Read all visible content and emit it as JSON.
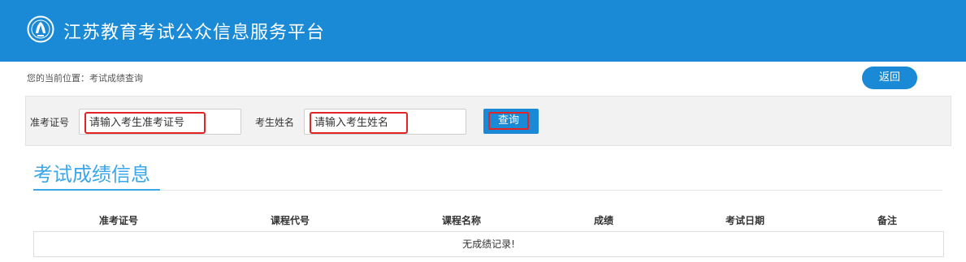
{
  "header": {
    "site_title": "江苏教育考试公众信息服务平台",
    "logo_icon": "exam-authority-emblem-icon",
    "bg_color": "#1a8ad6"
  },
  "breadcrumb": {
    "text": "您的当前位置：考试成绩查询"
  },
  "actions": {
    "back_label": "返回"
  },
  "search": {
    "ticket_label": "准考证号",
    "ticket_placeholder": "请输入考生准考证号",
    "name_label": "考生姓名",
    "name_placeholder": "请输入考生姓名",
    "query_label": "查询"
  },
  "section": {
    "title": "考试成绩信息",
    "title_color": "#3ba6e8"
  },
  "table": {
    "columns": [
      "准考证号",
      "课程代号",
      "课程名称",
      "成绩",
      "考试日期",
      "备注"
    ],
    "empty_message": "无成绩记录!"
  },
  "highlight_color": "#e32424"
}
